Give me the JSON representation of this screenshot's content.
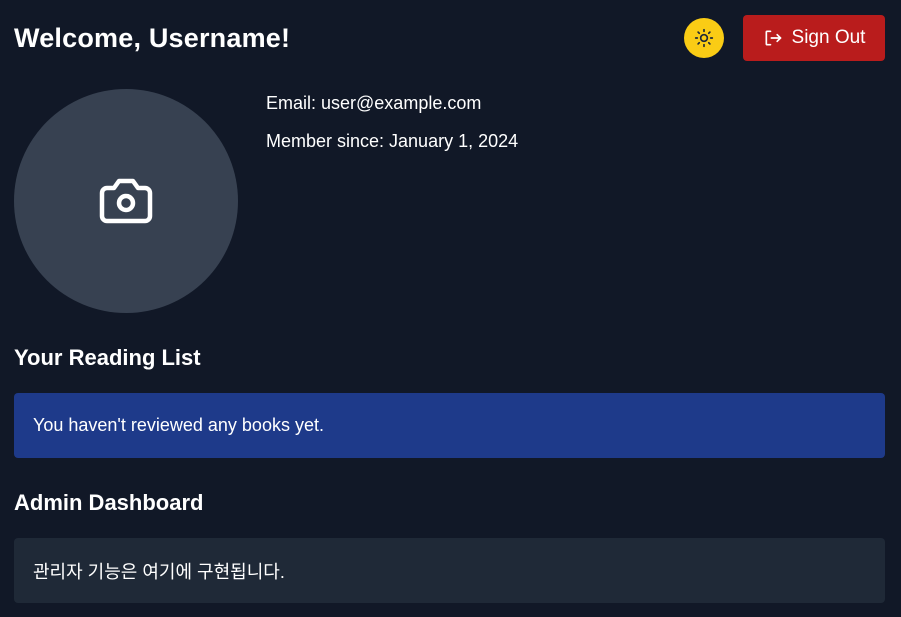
{
  "header": {
    "welcome": "Welcome, Username!",
    "theme_icon": "sun-icon",
    "theme_color": "#facc15",
    "signout_label": "Sign Out",
    "signout_icon": "logout-icon",
    "signout_color": "#b91c1c"
  },
  "profile": {
    "avatar_icon": "camera-icon",
    "email": "Email: user@example.com",
    "member_since": "Member since: January 1, 2024"
  },
  "reading_list": {
    "title": "Your Reading List",
    "empty_message": "You haven't reviewed any books yet.",
    "panel_color": "#1e3a8a"
  },
  "admin": {
    "title": "Admin Dashboard",
    "message": "관리자 기능은 여기에 구현됩니다.",
    "panel_color": "#1f2937"
  },
  "colors": {
    "background": "#111827",
    "avatar_bg": "#374151"
  }
}
